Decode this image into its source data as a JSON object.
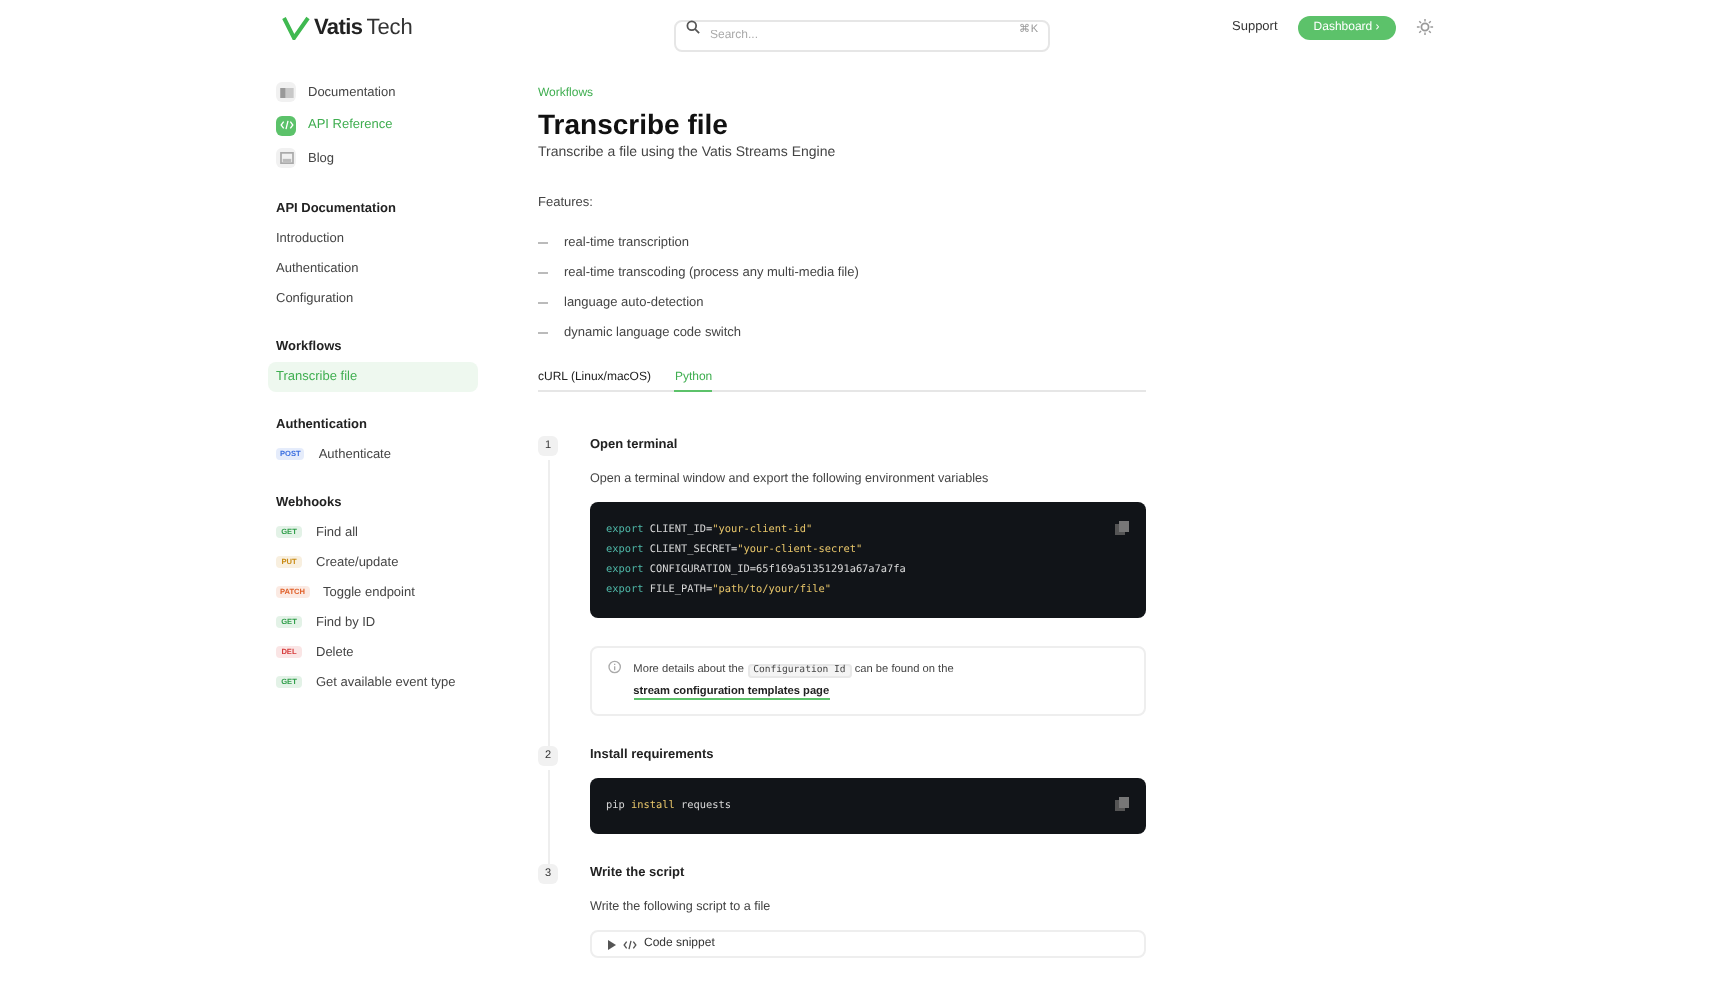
{
  "header": {
    "brand": {
      "name": "Vatis",
      "suffix": "Tech"
    },
    "search": {
      "placeholder": "Search...",
      "shortcut": "⌘K"
    },
    "support": "Support",
    "dashboard": "Dashboard ›"
  },
  "sidebar": {
    "top_links": [
      {
        "label": "Documentation",
        "kind": "docs",
        "selected": false
      },
      {
        "label": "API Reference",
        "kind": "api",
        "selected": true
      },
      {
        "label": "Blog",
        "kind": "blog",
        "selected": false
      }
    ],
    "sections": [
      {
        "title": "API Documentation",
        "items": [
          {
            "label": "Introduction",
            "selected": false
          },
          {
            "label": "Authentication",
            "selected": false
          },
          {
            "label": "Configuration",
            "selected": false
          }
        ]
      },
      {
        "title": "Workflows",
        "items": [
          {
            "label": "Transcribe file",
            "selected": true
          }
        ]
      },
      {
        "title": "Authentication",
        "items": [
          {
            "label": "Authenticate",
            "method": "POST",
            "color": "#3b6fe0",
            "selected": false
          }
        ]
      },
      {
        "title": "Webhooks",
        "items": [
          {
            "label": "Find all",
            "method": "GET",
            "color": "#2f9e4a",
            "selected": false
          },
          {
            "label": "Create/update",
            "method": "PUT",
            "color": "#c98a12",
            "selected": false
          },
          {
            "label": "Toggle endpoint",
            "method": "PATCH",
            "color": "#e0602a",
            "selected": false
          },
          {
            "label": "Find by ID",
            "method": "GET",
            "color": "#2f9e4a",
            "selected": false
          },
          {
            "label": "Delete",
            "method": "DEL",
            "color": "#d63b3b",
            "selected": false
          },
          {
            "label": "Get available event type",
            "method": "GET",
            "color": "#2f9e4a",
            "selected": false
          }
        ]
      }
    ]
  },
  "main": {
    "breadcrumb": "Workflows",
    "title": "Transcribe file",
    "subtitle": "Transcribe a file using the Vatis Streams Engine",
    "features_label": "Features:",
    "features": [
      "real-time transcription",
      "real-time transcoding (process any multi-media file)",
      "language auto-detection",
      "dynamic language code switch"
    ],
    "tabs": [
      {
        "label": "cURL (Linux/macOS)",
        "selected": false
      },
      {
        "label": "Python",
        "selected": true
      }
    ],
    "steps": [
      {
        "number": "1",
        "title": "Open terminal",
        "description": "Open a terminal window and export the following environment variables",
        "code": [
          {
            "keyword": "export",
            "name": "CLIENT_ID=",
            "value": "\"your-client-id\""
          },
          {
            "keyword": "export",
            "name": "CLIENT_SECRET=",
            "value": "\"your-client-secret\""
          },
          {
            "keyword": "export",
            "name": "CONFIGURATION_ID=65f169a51351291a67a7a7fa"
          },
          {
            "keyword": "export",
            "name": "FILE_PATH=",
            "value": "\"path/to/your/file\""
          }
        ],
        "note": {
          "before": "More details about the",
          "code": "Configuration Id",
          "middle": "can be found on the",
          "link": "stream configuration templates page"
        }
      },
      {
        "number": "2",
        "title": "Install requirements",
        "code": [
          {
            "keyword": "pip",
            "name": "install",
            "value": "requests",
            "kind": "pip"
          }
        ]
      },
      {
        "number": "3",
        "title": "Write the script",
        "description": "Write the following script to a file",
        "snippet": "Code snippet"
      }
    ]
  }
}
